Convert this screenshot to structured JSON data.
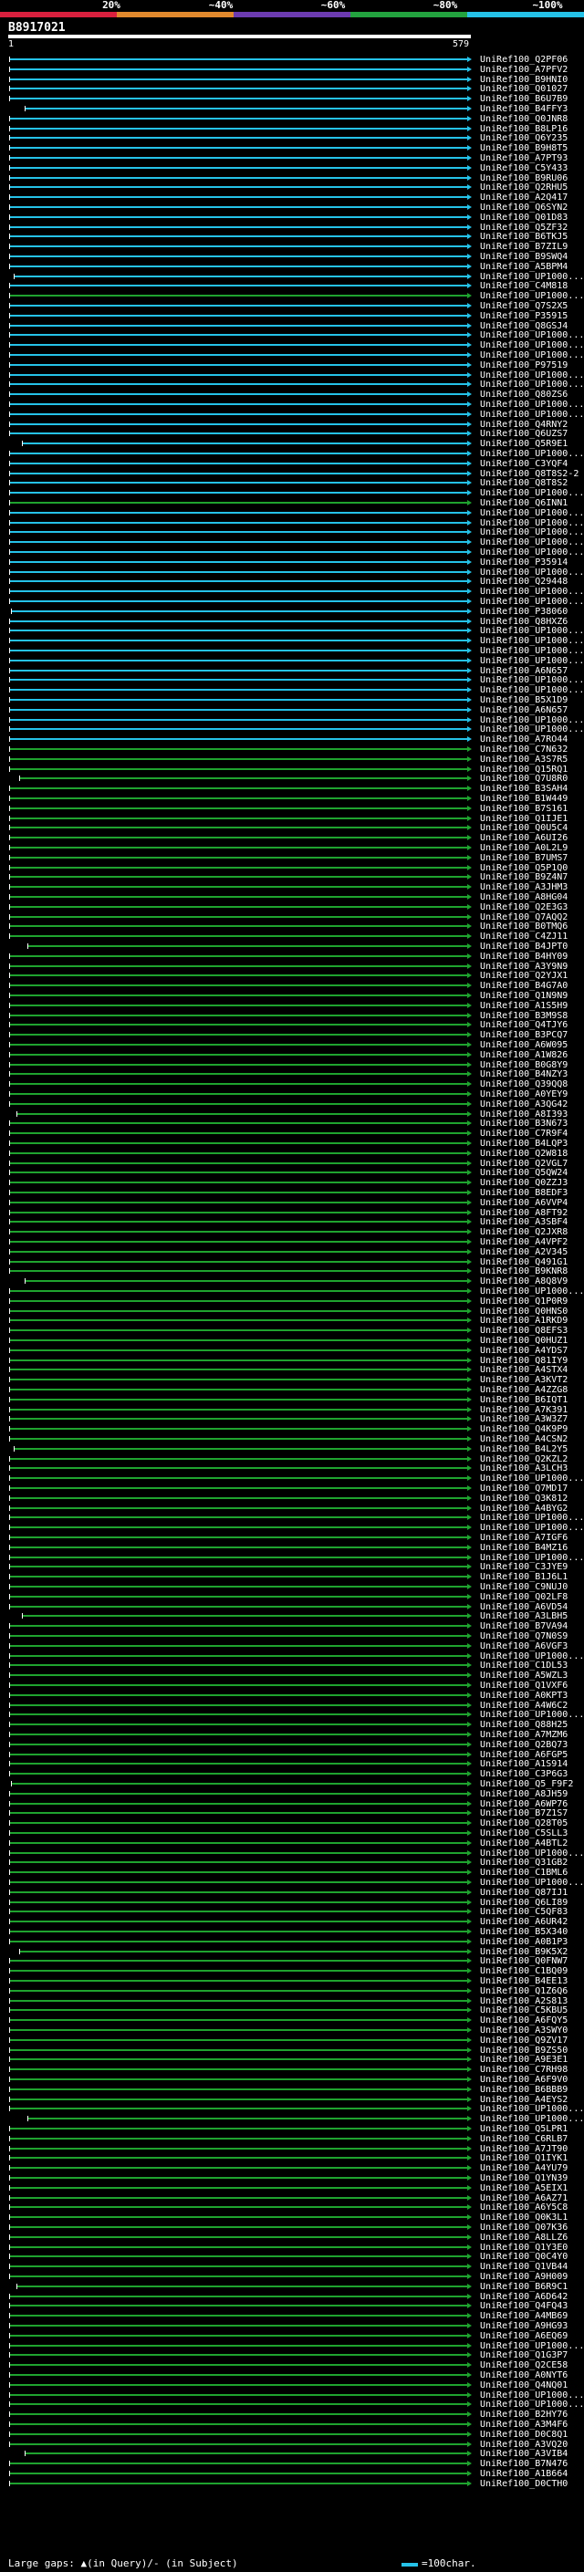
{
  "legend": {
    "labels": [
      "20%",
      "~40%",
      "~60%",
      "~80%",
      "~100%"
    ],
    "colors": [
      "#d9203e",
      "#e1892d",
      "#6c3bb0",
      "#23a33f",
      "#25c2e8"
    ]
  },
  "query": {
    "title": "B8917021",
    "start": "1",
    "end": "579"
  },
  "hits": [
    "UniRef100_Q2PF06",
    "UniRef100_A7PFV2",
    "UniRef100_B9HNI0",
    "UniRef100_Q01027",
    "UniRef100_B6U7B9",
    "UniRef100_B4FFY3",
    "UniRef100_Q0JNR8",
    "UniRef100_B8LP16",
    "UniRef100_Q6Y235",
    "UniRef100_B9H8T5",
    "UniRef100_A7PT93",
    "UniRef100_C5Y433",
    "UniRef100_B9RU06",
    "UniRef100_Q2RHU5",
    "UniRef100_A2Q417",
    "UniRef100_Q6SYN2",
    "UniRef100_Q01D83",
    "UniRef100_Q5ZF32",
    "UniRef100_B6TKJ5",
    "UniRef100_B7ZIL9",
    "UniRef100_B9SWQ4",
    "UniRef100_A5BPM4",
    "UniRef100_UP1000...",
    "UniRef100_C4M818",
    "UniRef100_UP1000...",
    "UniRef100_Q7S2X5",
    "UniRef100_P35915",
    "UniRef100_Q8GSJ4",
    "UniRef100_UP1000...",
    "UniRef100_UP1000...",
    "UniRef100_UP1000...",
    "UniRef100_P97519",
    "UniRef100_UP1000...",
    "UniRef100_UP1000...",
    "UniRef100_Q80ZS6",
    "UniRef100_UP1000...",
    "UniRef100_UP1000...",
    "UniRef100_Q4RNY2",
    "UniRef100_Q6UZS7",
    "UniRef100_Q5R9E1",
    "UniRef100_UP1000...",
    "UniRef100_C3YQF4",
    "UniRef100_Q8T8S2-2",
    "UniRef100_Q8T8S2",
    "UniRef100_UP1000...",
    "UniRef100_Q6INN1",
    "UniRef100_UP1000...",
    "UniRef100_UP1000...",
    "UniRef100_UP1000...",
    "UniRef100_UP1000...",
    "UniRef100_UP1000...",
    "UniRef100_P35914",
    "UniRef100_UP1000...",
    "UniRef100_Q29448",
    "UniRef100_UP1000...",
    "UniRef100_UP1000...",
    "UniRef100_P38060",
    "UniRef100_Q8HXZ6",
    "UniRef100_UP1000...",
    "UniRef100_UP1000...",
    "UniRef100_UP1000...",
    "UniRef100_UP1000...",
    "UniRef100_A6N657",
    "UniRef100_UP1000...",
    "UniRef100_UP1000...",
    "UniRef100_B5X1D9",
    "UniRef100_A6N657",
    "UniRef100_UP1000...",
    "UniRef100_UP1000...",
    "UniRef100_A7RO44",
    "UniRef100_C7N632",
    "UniRef100_A3S7R5",
    "UniRef100_Q15RQ1",
    "UniRef100_Q7U8R0",
    "UniRef100_B3SAH4",
    "UniRef100_B1W449",
    "UniRef100_B7S161",
    "UniRef100_Q1IJE1",
    "UniRef100_Q0U5C4",
    "UniRef100_A6UI26",
    "UniRef100_A0L2L9",
    "UniRef100_B7UMS7",
    "UniRef100_Q5P1Q0",
    "UniRef100_B9Z4N7",
    "UniRef100_A3JHM3",
    "UniRef100_A8HG04",
    "UniRef100_Q2E3G3",
    "UniRef100_Q7AQQ2",
    "UniRef100_B0TMQ6",
    "UniRef100_C4ZJ11",
    "UniRef100_B4JPT0",
    "UniRef100_B4HY09",
    "UniRef100_A3Y9N9",
    "UniRef100_Q2YJX1",
    "UniRef100_B4G7A0",
    "UniRef100_Q1N9N9",
    "UniRef100_A1S5H9",
    "UniRef100_B3M9S8",
    "UniRef100_Q4TJY6",
    "UniRef100_B3PCQ7",
    "UniRef100_A6W095",
    "UniRef100_A1W826",
    "UniRef100_B0G8Y9",
    "UniRef100_B4NZY3",
    "UniRef100_Q39QQ8",
    "UniRef100_A0YEY9",
    "UniRef100_A3QG42",
    "UniRef100_A8I393",
    "UniRef100_B3N673",
    "UniRef100_C7R9F4",
    "UniRef100_B4LQP3",
    "UniRef100_Q2W818",
    "UniRef100_Q2VGL7",
    "UniRef100_Q5QW24",
    "UniRef100_Q0ZZJ3",
    "UniRef100_B8EDF3",
    "UniRef100_A6VVP4",
    "UniRef100_A8FT92",
    "UniRef100_A3SBF4",
    "UniRef100_Q2JXR8",
    "UniRef100_A4VPF2",
    "UniRef100_A2V345",
    "UniRef100_Q491G1",
    "UniRef100_B9KNR8",
    "UniRef100_A8Q8V9",
    "UniRef100_UP1000...",
    "UniRef100_Q1P0R9",
    "UniRef100_Q0HNS0",
    "UniRef100_A1RKD9",
    "UniRef100_Q8EFS3",
    "UniRef100_Q0HUZ1",
    "UniRef100_A4YDS7",
    "UniRef100_Q81IY9",
    "UniRef100_A4STX4",
    "UniRef100_A3KVT2",
    "UniRef100_A4ZZG8",
    "UniRef100_B6IQT1",
    "UniRef100_A7K391",
    "UniRef100_A3W3Z7",
    "UniRef100_Q4K9P9",
    "UniRef100_A4CSN2",
    "UniRef100_B4L2Y5",
    "UniRef100_Q2KZL2",
    "UniRef100_A3LCH3",
    "UniRef100_UP1000...",
    "UniRef100_Q7MD17",
    "UniRef100_Q3K812",
    "UniRef100_A4BYG2",
    "UniRef100_UP1000...",
    "UniRef100_UP1000...",
    "UniRef100_A7IGF6",
    "UniRef100_B4MZ16",
    "UniRef100_UP1000...",
    "UniRef100_C3JYE9",
    "UniRef100_B1J6L1",
    "UniRef100_C9NUJ0",
    "UniRef100_Q02LF8",
    "UniRef100_A6VD54",
    "UniRef100_A3LBH5",
    "UniRef100_B7VA94",
    "UniRef100_Q7N0S9",
    "UniRef100_A6VGF3",
    "UniRef100_UP1000...",
    "UniRef100_C1DL53",
    "UniRef100_A5WZL3",
    "UniRef100_Q1VXF6",
    "UniRef100_A0KPT3",
    "UniRef100_A4W6C2",
    "UniRef100_UP1000...",
    "UniRef100_Q88H25",
    "UniRef100_A7MZM6",
    "UniRef100_Q2BQ73",
    "UniRef100_A6FGP5",
    "UniRef100_A1S914",
    "UniRef100_C3P6G3",
    "UniRef100_Q5_F9F2",
    "UniRef100_A8JH59",
    "UniRef100_A6WP76",
    "UniRef100_B7Z1S7",
    "UniRef100_Q28T05",
    "UniRef100_C5SLL3",
    "UniRef100_A4BTL2",
    "UniRef100_UP1000...",
    "UniRef100_Q31GB2",
    "UniRef100_C1BML6",
    "UniRef100_UP1000...",
    "UniRef100_Q87IJ1",
    "UniRef100_Q6LI89",
    "UniRef100_C5QF83",
    "UniRef100_A6UR42",
    "UniRef100_B5X340",
    "UniRef100_A0B1P3",
    "UniRef100_B9K5X2",
    "UniRef100_Q0FNW7",
    "UniRef100_C1BQ09",
    "UniRef100_B4EE13",
    "UniRef100_Q1Z6Q6",
    "UniRef100_A2S813",
    "UniRef100_C5KBU5",
    "UniRef100_A6FQY5",
    "UniRef100_A3SWY0",
    "UniRef100_Q9ZV17",
    "UniRef100_B9ZS50",
    "UniRef100_A9E3E1",
    "UniRef100_C7RH98",
    "UniRef100_A6F9V0",
    "UniRef100_B6BBB9",
    "UniRef100_A4EYS2",
    "UniRef100_UP1000...",
    "UniRef100_UP1000...",
    "UniRef100_Q5LPR1",
    "UniRef100_C6RLB7",
    "UniRef100_A7JT90",
    "UniRef100_Q1IYK1",
    "UniRef100_A4YU79",
    "UniRef100_Q1YN39",
    "UniRef100_A5EIX1",
    "UniRef100_A6AZ71",
    "UniRef100_A6Y5C8",
    "UniRef100_Q0K3L1",
    "UniRef100_Q07K36",
    "UniRef100_A8LLZ6",
    "UniRef100_Q1Y3E0",
    "UniRef100_Q0C4Y0",
    "UniRef100_Q1VB44",
    "UniRef100_A9H009",
    "UniRef100_B6R9C1",
    "UniRef100_A6D642",
    "UniRef100_Q4FQ43",
    "UniRef100_A4MB69",
    "UniRef100_A9HG93",
    "UniRef100_A6EQ69",
    "UniRef100_UP1000...",
    "UniRef100_Q1G3P7",
    "UniRef100_Q2CE58",
    "UniRef100_A0NYT6",
    "UniRef100_Q4NQ01",
    "UniRef100_UP1000...",
    "UniRef100_UP1000...",
    "UniRef100_B2HY76",
    "UniRef100_A3M4F6",
    "UniRef100_D0C8Q1",
    "UniRef100_A3VQ20",
    "UniRef100_A3VIB4",
    "UniRef100_B7N476",
    "UniRef100_A1B664",
    "UniRef100_D0CTH0"
  ],
  "footer": {
    "text": "Large gaps: ▲(in Query)/- (in Subject)",
    "scale": "=100char."
  }
}
